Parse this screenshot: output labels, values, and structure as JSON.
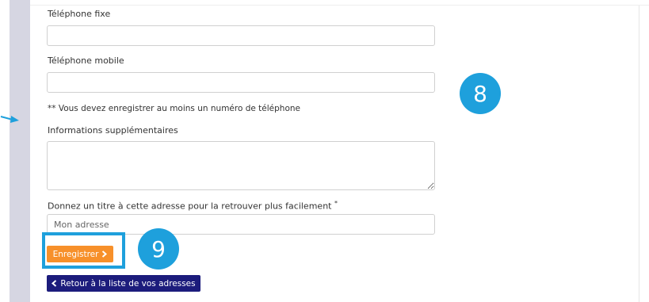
{
  "form": {
    "phone_fixed_label": "Téléphone fixe",
    "phone_fixed_value": "",
    "phone_mobile_label": "Téléphone mobile",
    "phone_mobile_value": "",
    "phone_note": "** Vous devez enregistrer au moins un numéro de téléphone",
    "extra_info_label": "Informations supplémentaires",
    "extra_info_value": "",
    "address_title_label": "Donnez un titre à cette adresse pour la retrouver plus facilement",
    "required_marker": "*",
    "address_title_placeholder": "Mon adresse"
  },
  "actions": {
    "save_label": "Enregistrer",
    "back_label": "Retour à la liste de vos adresses"
  },
  "annotations": {
    "step_8": "8",
    "step_9": "9"
  },
  "icons": {
    "side_arrow": "arrow-right-icon",
    "save_chevron": "chevron-right-icon",
    "back_chevron": "chevron-left-icon"
  },
  "colors": {
    "save_button": "#f7902a",
    "back_button": "#1c1c7c",
    "annotation": "#1ea0dc",
    "sidebar": "#d6d6e2"
  }
}
